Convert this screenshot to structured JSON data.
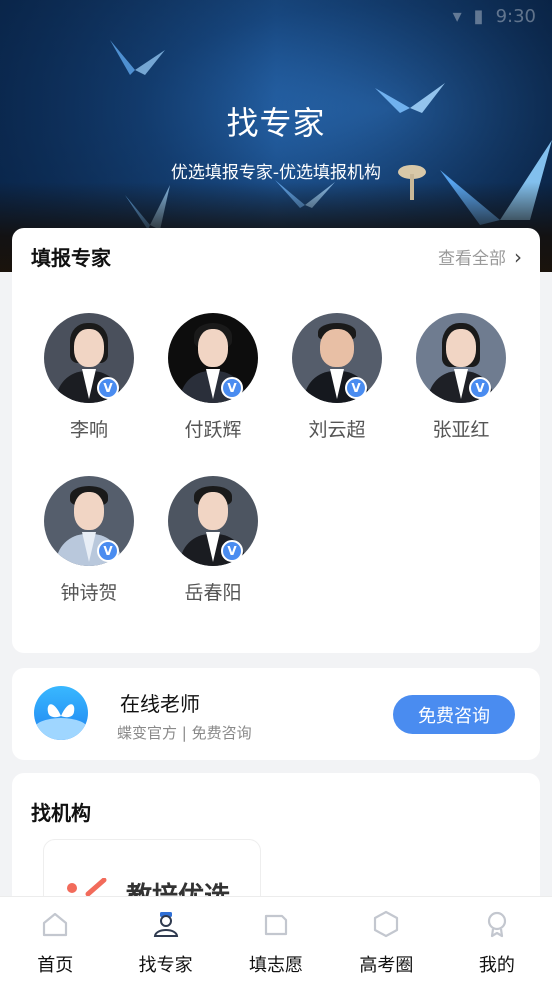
{
  "status_bar": {
    "time": "9:30"
  },
  "hero": {
    "title": "找专家",
    "subtitle": "优选填报专家-优选填报机构"
  },
  "experts_section": {
    "title": "填报专家",
    "see_all": "查看全部",
    "experts": [
      {
        "name": "李响",
        "verified": true
      },
      {
        "name": "付跃辉",
        "verified": true
      },
      {
        "name": "刘云超",
        "verified": true
      },
      {
        "name": "张亚红",
        "verified": true
      },
      {
        "name": "钟诗贺",
        "verified": true
      },
      {
        "name": "岳春阳",
        "verified": true
      }
    ],
    "badge_text": "V"
  },
  "online_teacher": {
    "title": "在线老师",
    "subtitle": "蝶变官方 | 免费咨询",
    "button": "免费咨询"
  },
  "institutions": {
    "title": "找机构",
    "items": [
      {
        "name": "教培优选"
      }
    ]
  },
  "bottom_nav": [
    {
      "label": "首页",
      "icon": "home-icon",
      "active": false
    },
    {
      "label": "找专家",
      "icon": "expert-icon",
      "active": true
    },
    {
      "label": "填志愿",
      "icon": "form-icon",
      "active": false
    },
    {
      "label": "高考圈",
      "icon": "hexagon-icon",
      "active": false
    },
    {
      "label": "我的",
      "icon": "profile-icon",
      "active": false
    }
  ],
  "colors": {
    "accent": "#4a8cf0",
    "text_primary": "#111111",
    "text_secondary": "#8a8a8a"
  }
}
